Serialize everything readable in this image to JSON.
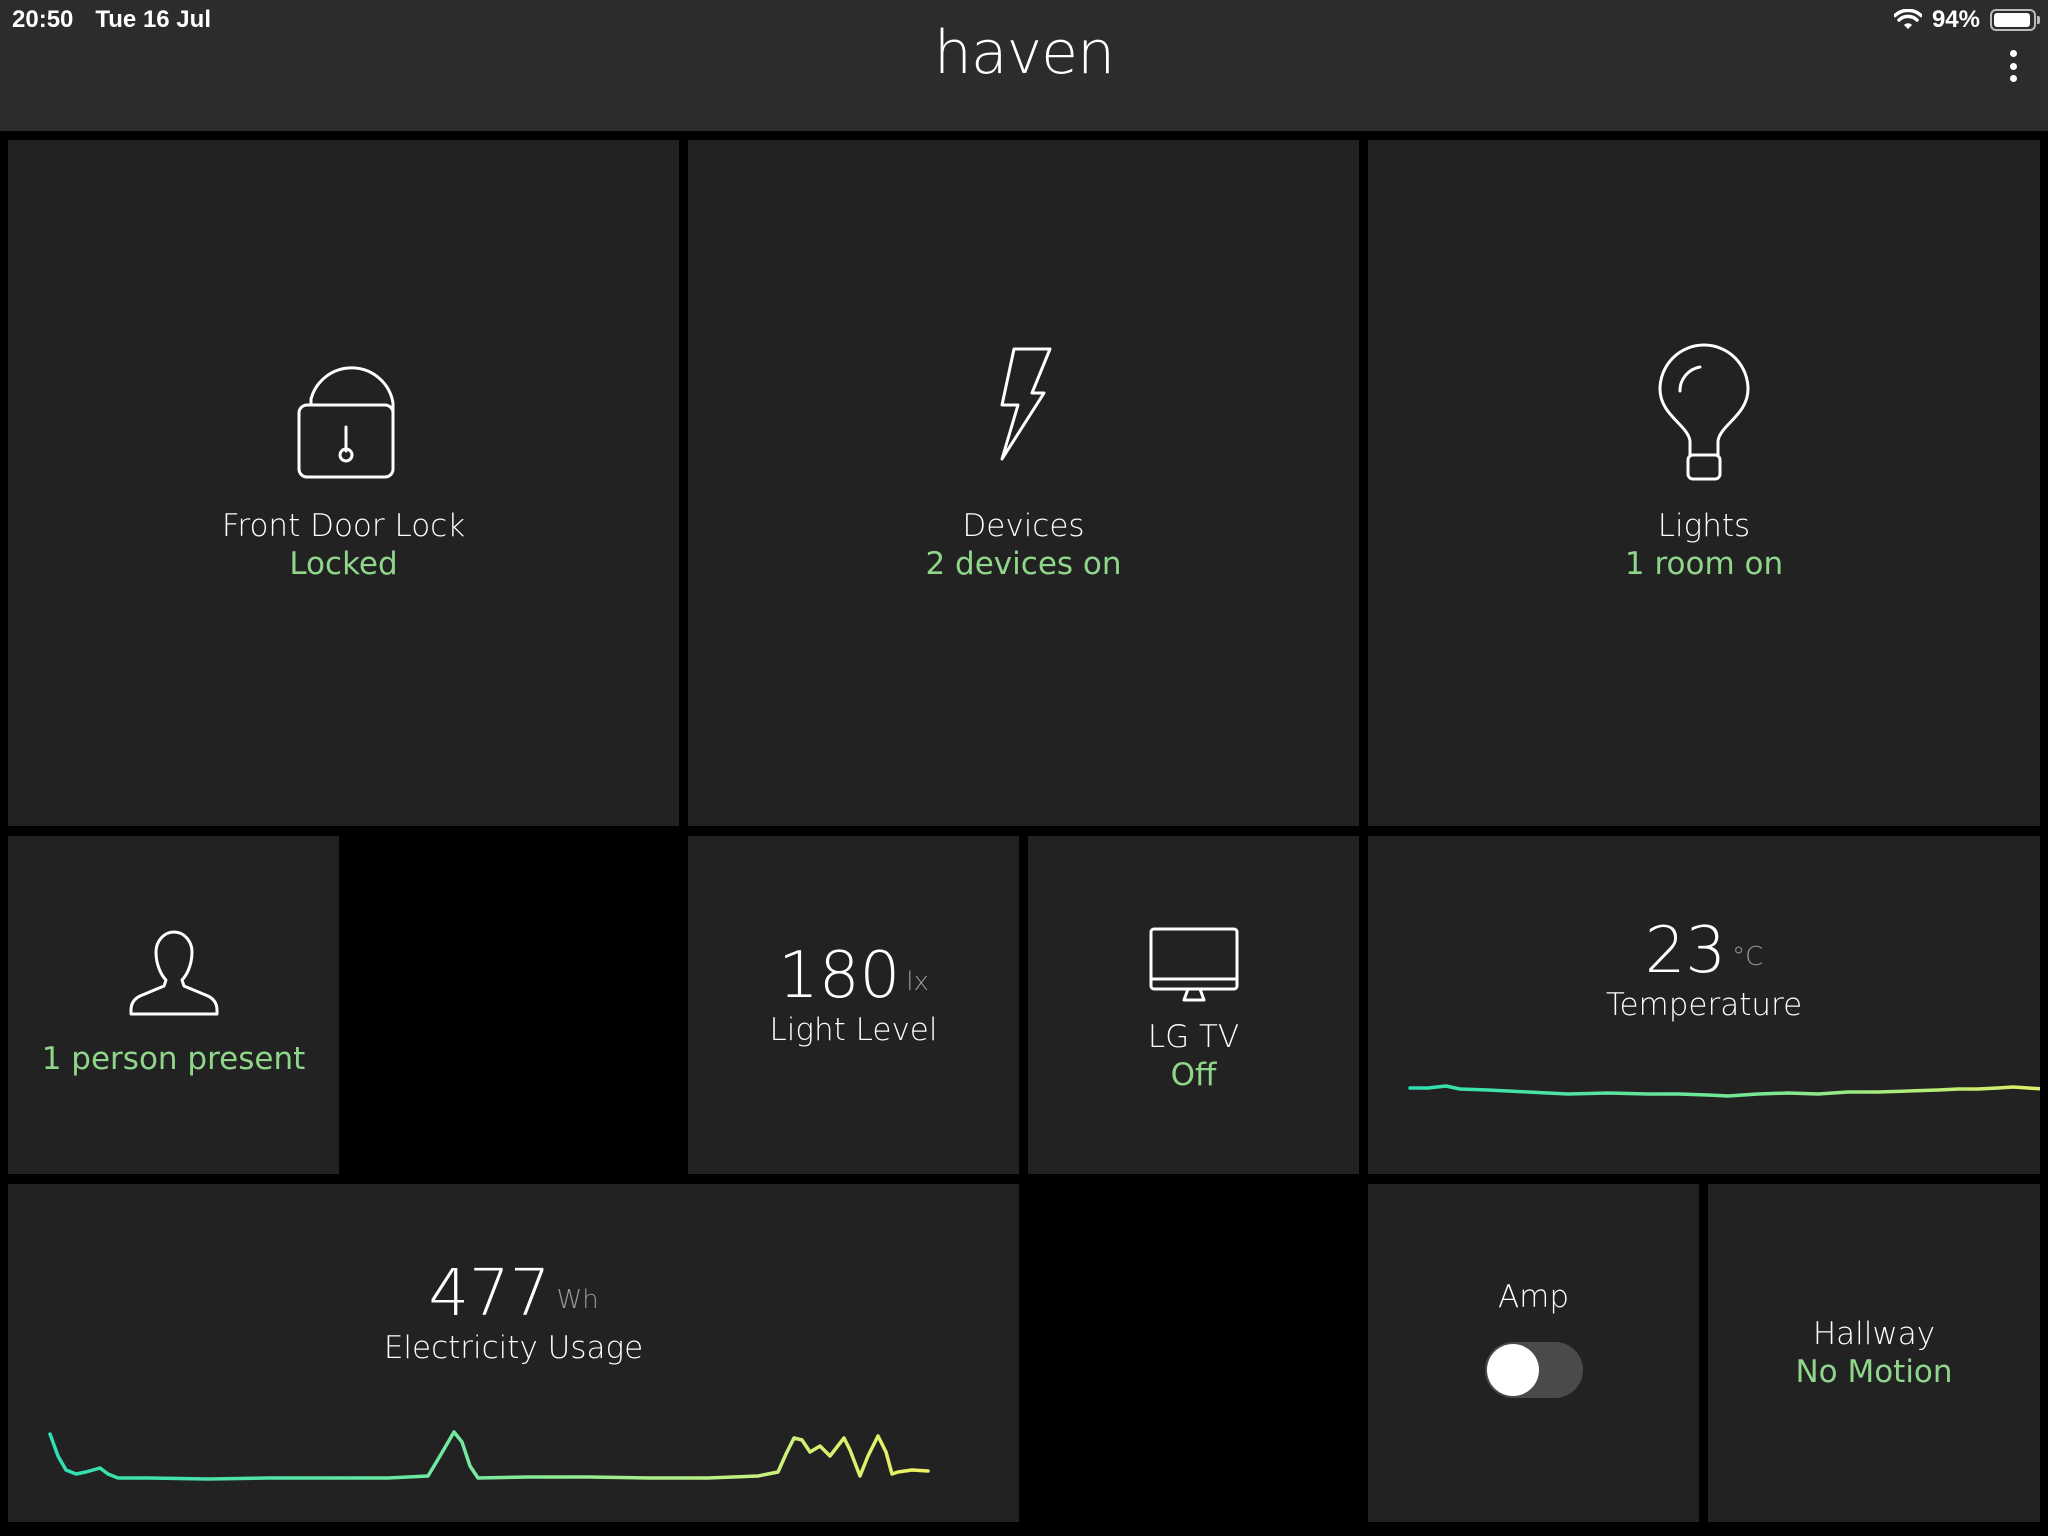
{
  "status_bar": {
    "time": "20:50",
    "date": "Tue 16 Jul",
    "battery": "94%",
    "battery_level": 0.94
  },
  "header": {
    "title": "haven"
  },
  "tiles": {
    "front_door": {
      "label": "Front Door Lock",
      "status": "Locked",
      "icon": "unlocked-padlock-icon"
    },
    "devices": {
      "label": "Devices",
      "status": "2 devices on",
      "icon": "lightning-bolt-icon"
    },
    "lights": {
      "label": "Lights",
      "status": "1 room on",
      "icon": "light-bulb-icon"
    },
    "presence": {
      "status": "1 person present",
      "icon": "person-icon"
    },
    "light_level": {
      "value": "180",
      "unit": "lx",
      "label": "Light Level"
    },
    "tv": {
      "label": "LG TV",
      "status": "Off",
      "icon": "monitor-icon"
    },
    "temperature": {
      "value": "23",
      "unit": "°C",
      "label": "Temperature"
    },
    "electricity": {
      "value": "477",
      "unit": "Wh",
      "label": "Electricity Usage"
    },
    "amp": {
      "label": "Amp",
      "toggle_on": false
    },
    "hallway": {
      "label": "Hallway",
      "status": "No Motion"
    }
  },
  "colors": {
    "status_green": "#8fd68a",
    "tile_bg": "#222222",
    "gradient_start": "#2ee0b0",
    "gradient_end": "#e8f060"
  }
}
